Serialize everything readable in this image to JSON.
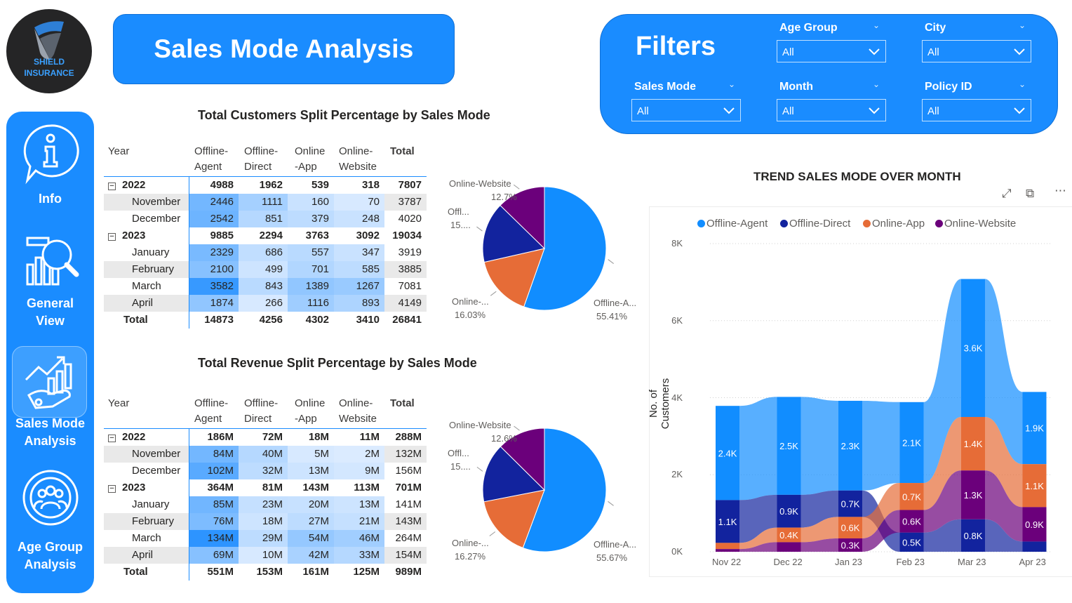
{
  "logo": {
    "line1": "SHIELD",
    "line2": "INSURANCE"
  },
  "page_title": "Sales Mode Analysis",
  "nav": [
    {
      "label_lines": [
        "Info"
      ],
      "icon": "info-icon"
    },
    {
      "label_lines": [
        "General",
        "View"
      ],
      "icon": "analytics-magnifier-icon"
    },
    {
      "label_lines": [
        "Sales Mode",
        "Analysis"
      ],
      "icon": "growth-hand-icon",
      "active": true
    },
    {
      "label_lines": [
        "Age Group",
        "Analysis"
      ],
      "icon": "group-target-icon"
    }
  ],
  "filters": {
    "title": "Filters",
    "items": [
      {
        "label": "Age Group",
        "value": "All"
      },
      {
        "label": "City",
        "value": "All"
      },
      {
        "label": "Sales Mode",
        "value": "All"
      },
      {
        "label": "Month",
        "value": "All"
      },
      {
        "label": "Policy ID",
        "value": "All"
      }
    ]
  },
  "customers_table": {
    "title": "Total Customers Split Percentage by Sales Mode",
    "columns": [
      "Year",
      "Offline-\nAgent",
      "Offline-\nDirect",
      "Online\n-App",
      "Online-\nWebsite",
      "Total"
    ],
    "rows": [
      {
        "label": "2022",
        "level": 0,
        "values": [
          "4988",
          "1962",
          "539",
          "318",
          "7807"
        ]
      },
      {
        "label": "November",
        "level": 1,
        "values": [
          "2446",
          "1111",
          "160",
          "70",
          "3787"
        ]
      },
      {
        "label": "December",
        "level": 1,
        "values": [
          "2542",
          "851",
          "379",
          "248",
          "4020"
        ]
      },
      {
        "label": "2023",
        "level": 0,
        "values": [
          "9885",
          "2294",
          "3763",
          "3092",
          "19034"
        ]
      },
      {
        "label": "January",
        "level": 1,
        "values": [
          "2329",
          "686",
          "557",
          "347",
          "3919"
        ]
      },
      {
        "label": "February",
        "level": 1,
        "values": [
          "2100",
          "499",
          "701",
          "585",
          "3885"
        ]
      },
      {
        "label": "March",
        "level": 1,
        "values": [
          "3582",
          "843",
          "1389",
          "1267",
          "7081"
        ]
      },
      {
        "label": "April",
        "level": 1,
        "values": [
          "1874",
          "266",
          "1116",
          "893",
          "4149"
        ]
      },
      {
        "label": "Total",
        "level": 2,
        "values": [
          "14873",
          "4256",
          "4302",
          "3410",
          "26841"
        ]
      }
    ],
    "heat": [
      null,
      [
        0.55,
        0.3,
        0.12,
        0.05
      ],
      [
        0.58,
        0.22,
        0.18,
        0.12
      ],
      null,
      [
        0.52,
        0.16,
        0.2,
        0.12
      ],
      [
        0.45,
        0.1,
        0.24,
        0.18
      ],
      [
        0.85,
        0.2,
        0.4,
        0.36
      ],
      [
        0.4,
        0.05,
        0.33,
        0.26
      ],
      null
    ]
  },
  "revenue_table": {
    "title": "Total Revenue Split Percentage by Sales Mode",
    "columns": [
      "Year",
      "Offline-\nAgent",
      "Offline-\nDirect",
      "Online\n-App",
      "Online-\nWebsite",
      "Total"
    ],
    "rows": [
      {
        "label": "2022",
        "level": 0,
        "values": [
          "186M",
          "72M",
          "18M",
          "11M",
          "288M"
        ]
      },
      {
        "label": "November",
        "level": 1,
        "values": [
          "84M",
          "40M",
          "5M",
          "2M",
          "132M"
        ]
      },
      {
        "label": "December",
        "level": 1,
        "values": [
          "102M",
          "32M",
          "13M",
          "9M",
          "156M"
        ]
      },
      {
        "label": "2023",
        "level": 0,
        "values": [
          "364M",
          "81M",
          "143M",
          "113M",
          "701M"
        ]
      },
      {
        "label": "January",
        "level": 1,
        "values": [
          "85M",
          "23M",
          "20M",
          "13M",
          "141M"
        ]
      },
      {
        "label": "February",
        "level": 1,
        "values": [
          "76M",
          "18M",
          "27M",
          "21M",
          "143M"
        ]
      },
      {
        "label": "March",
        "level": 1,
        "values": [
          "134M",
          "29M",
          "54M",
          "46M",
          "264M"
        ]
      },
      {
        "label": "April",
        "level": 1,
        "values": [
          "69M",
          "10M",
          "42M",
          "33M",
          "154M"
        ]
      },
      {
        "label": "Total",
        "level": 2,
        "values": [
          "551M",
          "153M",
          "161M",
          "125M",
          "989M"
        ]
      }
    ],
    "heat": [
      null,
      [
        0.55,
        0.22,
        0.05,
        0.03
      ],
      [
        0.68,
        0.18,
        0.1,
        0.07
      ],
      null,
      [
        0.56,
        0.14,
        0.13,
        0.1
      ],
      [
        0.5,
        0.1,
        0.18,
        0.14
      ],
      [
        0.9,
        0.18,
        0.38,
        0.32
      ],
      [
        0.45,
        0.05,
        0.28,
        0.22
      ],
      null
    ]
  },
  "colors": {
    "brand": "#1a8cff",
    "offline_agent": "#118dff",
    "offline_direct": "#12239e",
    "online_app": "#e66c37",
    "online_website": "#6b007b"
  },
  "chart_data": [
    {
      "type": "pie",
      "labels": [
        "Offline-A...",
        "Online-...",
        "Offl...",
        "Online-Website"
      ],
      "series_names": [
        "Offline-Agent",
        "Online-App",
        "Offline-Direct",
        "Online-Website"
      ],
      "values": [
        55.41,
        16.03,
        15.86,
        12.7
      ],
      "value_labels": [
        "55.41%",
        "16.03%",
        "15....",
        "12.7%"
      ]
    },
    {
      "type": "pie",
      "labels": [
        "Offline-A...",
        "Online-...",
        "Offl...",
        "Online-Website"
      ],
      "series_names": [
        "Offline-Agent",
        "Online-App",
        "Offline-Direct",
        "Online-Website"
      ],
      "values": [
        55.67,
        16.27,
        15.46,
        12.6
      ],
      "value_labels": [
        "55.67%",
        "16.27%",
        "15....",
        "12.6%"
      ]
    },
    {
      "type": "area",
      "title": "TREND SALES MODE OVER MONTH",
      "xlabel": "",
      "ylabel": "No. of Customers",
      "categories": [
        "Nov 22",
        "Dec 22",
        "Jan 23",
        "Feb 23",
        "Mar 23",
        "Apr 23"
      ],
      "ylim": [
        0,
        8000
      ],
      "yticks": [
        "0K",
        "2K",
        "4K",
        "6K",
        "8K"
      ],
      "legend": "top",
      "series": [
        {
          "name": "Offline-Agent",
          "values": [
            2446,
            2542,
            2329,
            2100,
            3582,
            1874
          ],
          "labels": [
            "2.4K",
            "2.5K",
            "2.3K",
            "2.1K",
            "3.6K",
            "1.9K"
          ]
        },
        {
          "name": "Offline-Direct",
          "values": [
            1111,
            851,
            686,
            499,
            843,
            266
          ],
          "labels": [
            "1.1K",
            "0.9K",
            "0.7K",
            "0.5K",
            "0.8K",
            ""
          ]
        },
        {
          "name": "Online-App",
          "values": [
            160,
            379,
            557,
            701,
            1389,
            1116
          ],
          "labels": [
            "",
            "0.4K",
            "0.6K",
            "0.7K",
            "1.4K",
            "1.1K"
          ]
        },
        {
          "name": "Online-Website",
          "values": [
            70,
            248,
            347,
            585,
            1267,
            893
          ],
          "labels": [
            "",
            "",
            "0.3K",
            "0.6K",
            "1.3K",
            "0.9K"
          ]
        }
      ]
    }
  ]
}
